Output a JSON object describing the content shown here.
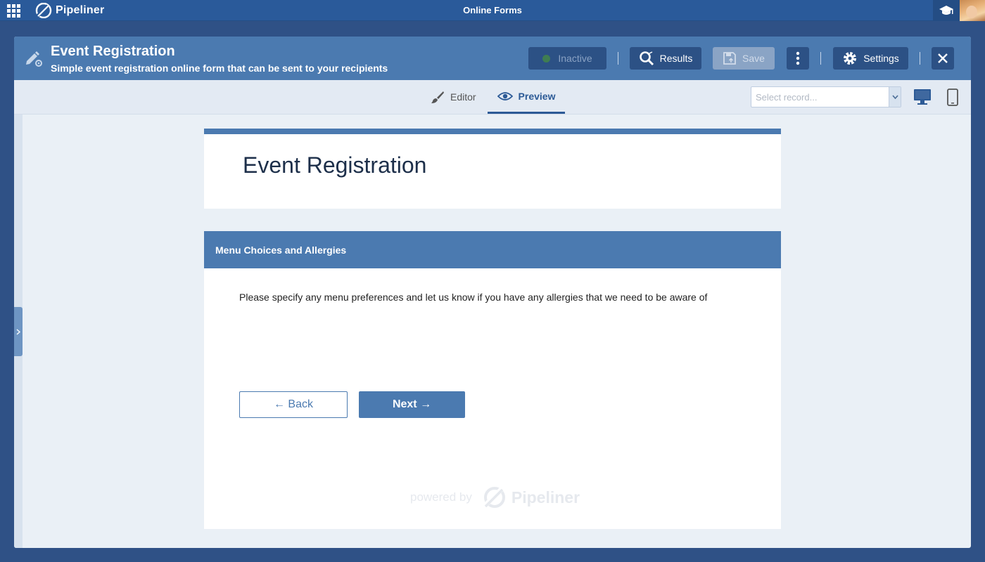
{
  "topbar": {
    "brand": "Pipeliner",
    "app_title": "Online Forms"
  },
  "header": {
    "title": "Event Registration",
    "subtitle": "Simple event registration online form that can be sent to your recipients",
    "buttons": {
      "inactive": "Inactive",
      "results": "Results",
      "save": "Save",
      "settings": "Settings"
    }
  },
  "tabs": {
    "editor": "Editor",
    "preview": "Preview",
    "active": "preview"
  },
  "record_select": {
    "placeholder": "Select record..."
  },
  "form": {
    "title": "Event Registration",
    "section_title": "Menu Choices and Allergies",
    "section_text": "Please specify any menu preferences and let us know if you have any allergies that we need to be aware of",
    "back_label": "← Back",
    "next_label": "Next →",
    "powered_by": "powered by",
    "powered_brand": "Pipeliner"
  },
  "colors": {
    "accent": "#4b7ab0",
    "dark_button": "#2c5185",
    "app_bar": "#2a5a9a"
  }
}
